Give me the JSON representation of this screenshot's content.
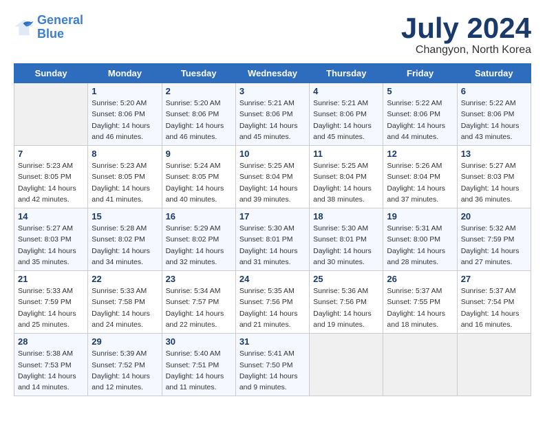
{
  "logo": {
    "line1": "General",
    "line2": "Blue"
  },
  "title": "July 2024",
  "subtitle": "Changyon, North Korea",
  "weekdays": [
    "Sunday",
    "Monday",
    "Tuesday",
    "Wednesday",
    "Thursday",
    "Friday",
    "Saturday"
  ],
  "weeks": [
    [
      {
        "day": "",
        "info": ""
      },
      {
        "day": "1",
        "info": "Sunrise: 5:20 AM\nSunset: 8:06 PM\nDaylight: 14 hours\nand 46 minutes."
      },
      {
        "day": "2",
        "info": "Sunrise: 5:20 AM\nSunset: 8:06 PM\nDaylight: 14 hours\nand 46 minutes."
      },
      {
        "day": "3",
        "info": "Sunrise: 5:21 AM\nSunset: 8:06 PM\nDaylight: 14 hours\nand 45 minutes."
      },
      {
        "day": "4",
        "info": "Sunrise: 5:21 AM\nSunset: 8:06 PM\nDaylight: 14 hours\nand 45 minutes."
      },
      {
        "day": "5",
        "info": "Sunrise: 5:22 AM\nSunset: 8:06 PM\nDaylight: 14 hours\nand 44 minutes."
      },
      {
        "day": "6",
        "info": "Sunrise: 5:22 AM\nSunset: 8:06 PM\nDaylight: 14 hours\nand 43 minutes."
      }
    ],
    [
      {
        "day": "7",
        "info": "Sunrise: 5:23 AM\nSunset: 8:05 PM\nDaylight: 14 hours\nand 42 minutes."
      },
      {
        "day": "8",
        "info": "Sunrise: 5:23 AM\nSunset: 8:05 PM\nDaylight: 14 hours\nand 41 minutes."
      },
      {
        "day": "9",
        "info": "Sunrise: 5:24 AM\nSunset: 8:05 PM\nDaylight: 14 hours\nand 40 minutes."
      },
      {
        "day": "10",
        "info": "Sunrise: 5:25 AM\nSunset: 8:04 PM\nDaylight: 14 hours\nand 39 minutes."
      },
      {
        "day": "11",
        "info": "Sunrise: 5:25 AM\nSunset: 8:04 PM\nDaylight: 14 hours\nand 38 minutes."
      },
      {
        "day": "12",
        "info": "Sunrise: 5:26 AM\nSunset: 8:04 PM\nDaylight: 14 hours\nand 37 minutes."
      },
      {
        "day": "13",
        "info": "Sunrise: 5:27 AM\nSunset: 8:03 PM\nDaylight: 14 hours\nand 36 minutes."
      }
    ],
    [
      {
        "day": "14",
        "info": "Sunrise: 5:27 AM\nSunset: 8:03 PM\nDaylight: 14 hours\nand 35 minutes."
      },
      {
        "day": "15",
        "info": "Sunrise: 5:28 AM\nSunset: 8:02 PM\nDaylight: 14 hours\nand 34 minutes."
      },
      {
        "day": "16",
        "info": "Sunrise: 5:29 AM\nSunset: 8:02 PM\nDaylight: 14 hours\nand 32 minutes."
      },
      {
        "day": "17",
        "info": "Sunrise: 5:30 AM\nSunset: 8:01 PM\nDaylight: 14 hours\nand 31 minutes."
      },
      {
        "day": "18",
        "info": "Sunrise: 5:30 AM\nSunset: 8:01 PM\nDaylight: 14 hours\nand 30 minutes."
      },
      {
        "day": "19",
        "info": "Sunrise: 5:31 AM\nSunset: 8:00 PM\nDaylight: 14 hours\nand 28 minutes."
      },
      {
        "day": "20",
        "info": "Sunrise: 5:32 AM\nSunset: 7:59 PM\nDaylight: 14 hours\nand 27 minutes."
      }
    ],
    [
      {
        "day": "21",
        "info": "Sunrise: 5:33 AM\nSunset: 7:59 PM\nDaylight: 14 hours\nand 25 minutes."
      },
      {
        "day": "22",
        "info": "Sunrise: 5:33 AM\nSunset: 7:58 PM\nDaylight: 14 hours\nand 24 minutes."
      },
      {
        "day": "23",
        "info": "Sunrise: 5:34 AM\nSunset: 7:57 PM\nDaylight: 14 hours\nand 22 minutes."
      },
      {
        "day": "24",
        "info": "Sunrise: 5:35 AM\nSunset: 7:56 PM\nDaylight: 14 hours\nand 21 minutes."
      },
      {
        "day": "25",
        "info": "Sunrise: 5:36 AM\nSunset: 7:56 PM\nDaylight: 14 hours\nand 19 minutes."
      },
      {
        "day": "26",
        "info": "Sunrise: 5:37 AM\nSunset: 7:55 PM\nDaylight: 14 hours\nand 18 minutes."
      },
      {
        "day": "27",
        "info": "Sunrise: 5:37 AM\nSunset: 7:54 PM\nDaylight: 14 hours\nand 16 minutes."
      }
    ],
    [
      {
        "day": "28",
        "info": "Sunrise: 5:38 AM\nSunset: 7:53 PM\nDaylight: 14 hours\nand 14 minutes."
      },
      {
        "day": "29",
        "info": "Sunrise: 5:39 AM\nSunset: 7:52 PM\nDaylight: 14 hours\nand 12 minutes."
      },
      {
        "day": "30",
        "info": "Sunrise: 5:40 AM\nSunset: 7:51 PM\nDaylight: 14 hours\nand 11 minutes."
      },
      {
        "day": "31",
        "info": "Sunrise: 5:41 AM\nSunset: 7:50 PM\nDaylight: 14 hours\nand 9 minutes."
      },
      {
        "day": "",
        "info": ""
      },
      {
        "day": "",
        "info": ""
      },
      {
        "day": "",
        "info": ""
      }
    ]
  ]
}
